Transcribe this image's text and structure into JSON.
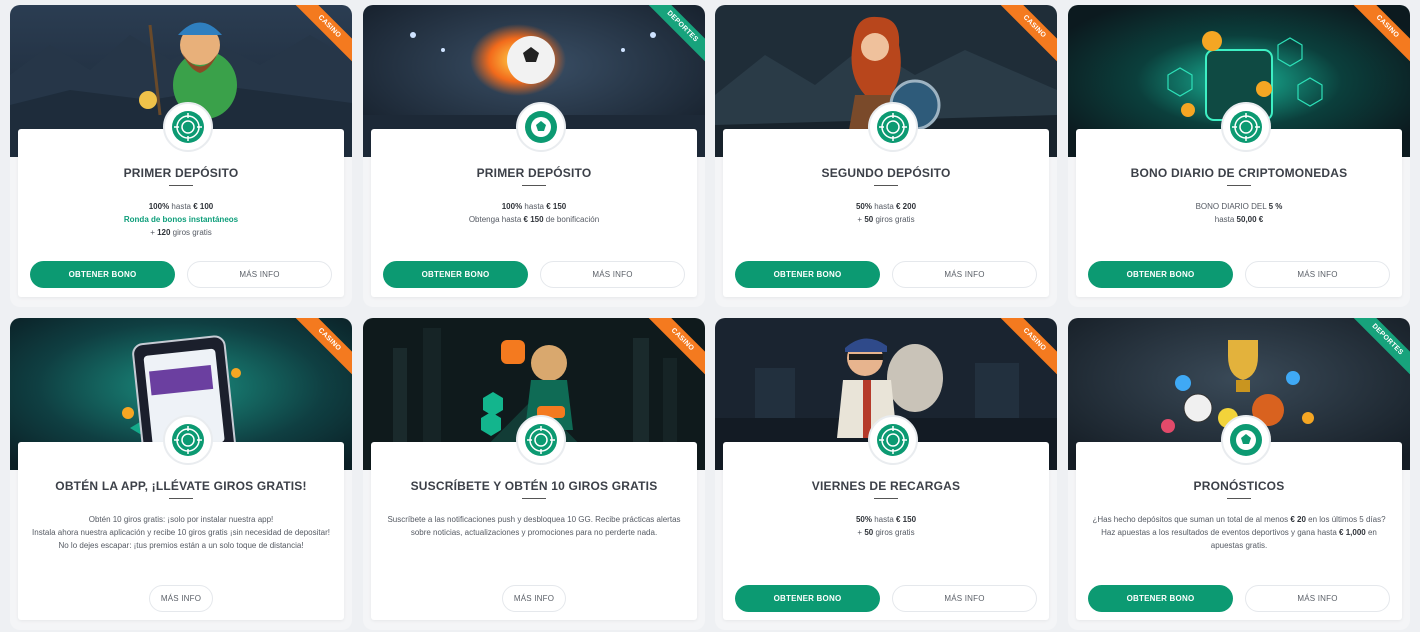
{
  "colors": {
    "accent": "#0c9a72",
    "casino_ribbon": "#f47a1f",
    "deportes_ribbon": "#17a37c"
  },
  "cards": [
    {
      "ribbon": "Casino",
      "icon": "casino-chip-icon",
      "title": "PRIMER DEPÓSITO",
      "lines": [
        {
          "bold": "100%",
          "rest": " hasta ",
          "bold2": "€ 100"
        },
        {
          "accent": "Ronda de bonos instantáneos"
        },
        {
          "rest": "+ ",
          "bold": "120",
          "rest2": " giros gratis"
        }
      ],
      "primary": "OBTENER BONO",
      "secondary": "MÁS INFO"
    },
    {
      "ribbon": "Deportes",
      "icon": "football-icon",
      "title": "PRIMER DEPÓSITO",
      "lines": [
        {
          "bold": "100%",
          "rest": " hasta ",
          "bold2": "€ 150"
        },
        {
          "rest": "Obtenga hasta ",
          "bold": "€ 150",
          "rest2": " de bonificación"
        }
      ],
      "primary": "OBTENER BONO",
      "secondary": "MÁS INFO"
    },
    {
      "ribbon": "Casino",
      "icon": "casino-chip-icon",
      "title": "SEGUNDO DEPÓSITO",
      "lines": [
        {
          "bold": "50%",
          "rest": " hasta ",
          "bold2": "€ 200"
        },
        {
          "rest": "+ ",
          "bold": "50",
          "rest2": " giros gratis"
        }
      ],
      "primary": "OBTENER BONO",
      "secondary": "MÁS INFO"
    },
    {
      "ribbon": "Casino",
      "icon": "casino-chip-icon",
      "title": "BONO DIARIO DE CRIPTOMONEDAS",
      "lines": [
        {
          "rest": "BONO DIARIO DEL ",
          "bold": "5 %"
        },
        {
          "rest": "hasta ",
          "bold": "50,00 €"
        }
      ],
      "primary": "OBTENER BONO",
      "secondary": "MÁS INFO"
    },
    {
      "ribbon": "Casino",
      "icon": "casino-chip-icon",
      "title": "OBTÉN LA APP, ¡LLÉVATE GIROS GRATIS!",
      "lines": [
        {
          "rest": "Obtén 10 giros gratis: ¡solo por instalar nuestra app!"
        },
        {
          "rest": "Instala ahora nuestra aplicación y recibe 10 giros gratis ¡sin necesidad de depositar!"
        },
        {
          "rest": "No lo dejes escapar: ¡tus premios están a un solo toque de distancia!"
        }
      ],
      "primary": "",
      "secondary": "MÁS INFO"
    },
    {
      "ribbon": "Casino",
      "icon": "casino-chip-icon",
      "title": "SUSCRÍBETE Y OBTÉN 10 GIROS GRATIS",
      "lines": [
        {
          "rest": "Suscríbete a las notificaciones push y desbloquea 10 GG. Recibe prácticas alertas sobre noticias, actualizaciones y promociones para no perderte nada."
        }
      ],
      "primary": "",
      "secondary": "MÁS INFO"
    },
    {
      "ribbon": "Casino",
      "icon": "casino-chip-icon",
      "title": "VIERNES DE RECARGAS",
      "lines": [
        {
          "bold": "50%",
          "rest": " hasta ",
          "bold2": "€ 150"
        },
        {
          "rest": "+ ",
          "bold": "50",
          "rest2": " giros gratis"
        }
      ],
      "primary": "OBTENER BONO",
      "secondary": "MÁS INFO"
    },
    {
      "ribbon": "Deportes",
      "icon": "football-icon",
      "title": "PRONÓSTICOS",
      "lines": [
        {
          "rest": "¿Has hecho depósitos que suman un total de al menos ",
          "bold": "€ 20",
          "rest2": " en los últimos 5 días?"
        },
        {
          "rest": "Haz apuestas a los resultados de eventos deportivos y gana hasta ",
          "bold": "€ 1,000",
          "rest2": " en apuestas gratis."
        }
      ],
      "primary": "OBTENER BONO",
      "secondary": "MÁS INFO"
    }
  ]
}
